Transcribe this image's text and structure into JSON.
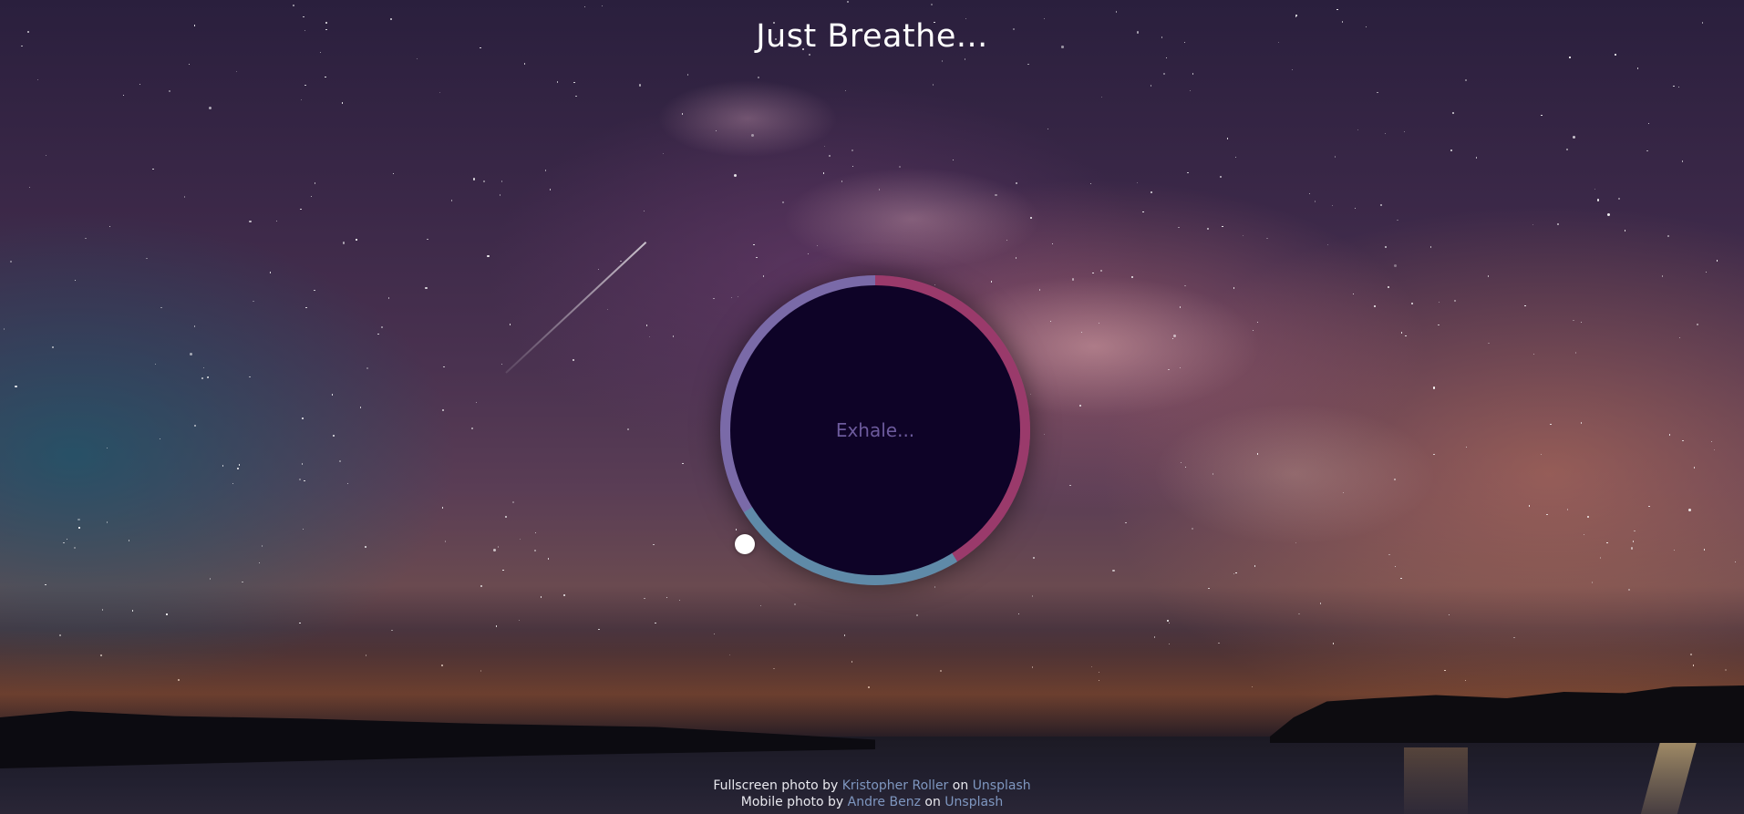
{
  "app": {
    "title": "Just Breathe..."
  },
  "breather": {
    "instruction": "Exhale...",
    "ring_colors": {
      "hold_segment": "#9a3a6b",
      "exhale_segment": "#5f8aa8",
      "inhale_segment": "#7a6aa8"
    },
    "inner_color": "#0e0327"
  },
  "credits": {
    "fullscreen": {
      "prefix": "Fullscreen photo by",
      "author": "Kristopher Roller",
      "joiner": "on",
      "site": "Unsplash"
    },
    "mobile": {
      "prefix": "Mobile photo by",
      "author": "Andre Benz",
      "joiner": "on",
      "site": "Unsplash"
    }
  }
}
